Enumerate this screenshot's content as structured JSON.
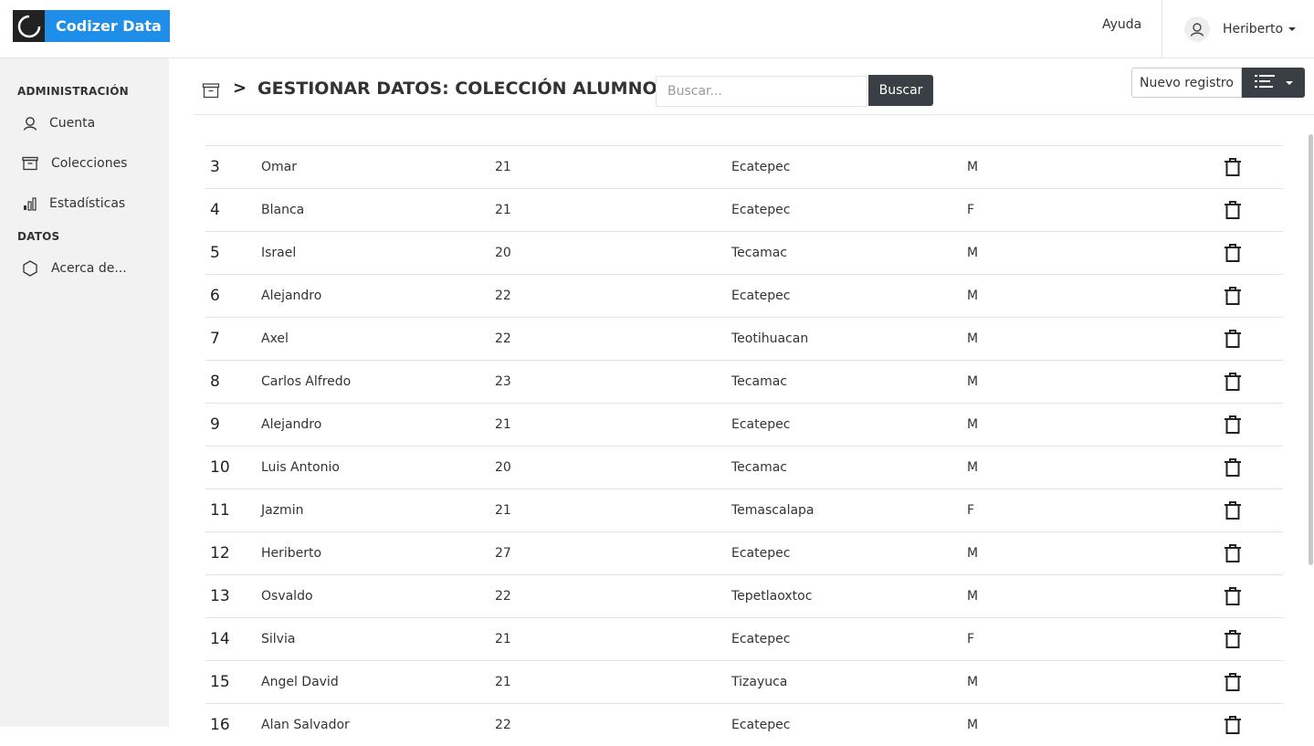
{
  "brand": {
    "name": "Codizer Data",
    "color": "#1e8ee8"
  },
  "topnav": {
    "help_label": "Ayuda",
    "user_name": "Heriberto"
  },
  "sidebar": {
    "admin_heading": "ADMINISTRACIÓN",
    "items": [
      {
        "label": "Cuenta",
        "icon": "user-icon"
      },
      {
        "label": "Colecciones",
        "icon": "archive-icon"
      },
      {
        "label": "Estadísticas",
        "icon": "bar-chart-icon"
      }
    ],
    "data_heading": "DATOS",
    "data_items": [
      {
        "label": "Acerca de...",
        "icon": "hexagon-icon"
      }
    ]
  },
  "header": {
    "separator": ">",
    "title": "GESTIONAR DATOS: COLECCIÓN ALUMNOS",
    "search_placeholder": "Buscar...",
    "search_button": "Buscar",
    "new_button": "Nuevo registro"
  },
  "table": {
    "rows": [
      {
        "id": "3",
        "name": "Omar",
        "age": "21",
        "city": "Ecatepec",
        "sex": "M"
      },
      {
        "id": "4",
        "name": "Blanca",
        "age": "21",
        "city": "Ecatepec",
        "sex": "F"
      },
      {
        "id": "5",
        "name": "Israel",
        "age": "20",
        "city": "Tecamac",
        "sex": "M"
      },
      {
        "id": "6",
        "name": "Alejandro",
        "age": "22",
        "city": "Ecatepec",
        "sex": "M"
      },
      {
        "id": "7",
        "name": "Axel",
        "age": "22",
        "city": "Teotihuacan",
        "sex": "M"
      },
      {
        "id": "8",
        "name": "Carlos Alfredo",
        "age": "23",
        "city": "Tecamac",
        "sex": "M"
      },
      {
        "id": "9",
        "name": "Alejandro",
        "age": "21",
        "city": "Ecatepec",
        "sex": "M"
      },
      {
        "id": "10",
        "name": "Luis Antonio",
        "age": "20",
        "city": "Tecamac",
        "sex": "M"
      },
      {
        "id": "11",
        "name": "Jazmin",
        "age": "21",
        "city": "Temascalapa",
        "sex": "F"
      },
      {
        "id": "12",
        "name": "Heriberto",
        "age": "27",
        "city": "Ecatepec",
        "sex": "M"
      },
      {
        "id": "13",
        "name": "Osvaldo",
        "age": "22",
        "city": "Tepetlaoxtoc",
        "sex": "M"
      },
      {
        "id": "14",
        "name": "Silvia",
        "age": "21",
        "city": "Ecatepec",
        "sex": "F"
      },
      {
        "id": "15",
        "name": "Angel David",
        "age": "21",
        "city": "Tizayuca",
        "sex": "M"
      },
      {
        "id": "16",
        "name": "Alan Salvador",
        "age": "22",
        "city": "Ecatepec",
        "sex": "M"
      }
    ]
  }
}
